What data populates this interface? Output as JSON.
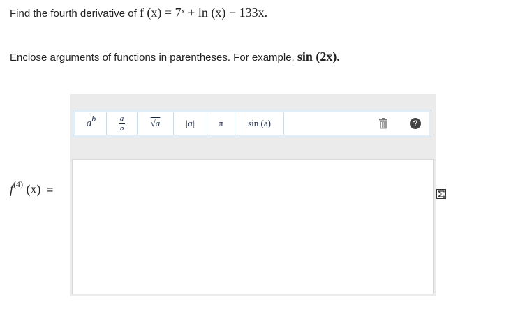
{
  "question": {
    "prefix": "Find the fourth derivative of",
    "expression": "f (x) = 7ˣ + ln (x) − 133x."
  },
  "instructions": {
    "text": "Enclose arguments of functions in parentheses. For example,",
    "example": "sin (2x)."
  },
  "toolbar": {
    "power_base": "a",
    "power_exp": "b",
    "frac_num": "a",
    "frac_den": "b",
    "sqrt_label": "√a",
    "abs_label": "|a|",
    "pi_label": "π",
    "sin_label": "sin (a)",
    "help_label": "?"
  },
  "answer": {
    "lhs_f": "f",
    "lhs_order": "(4)",
    "lhs_arg": "(x)",
    "equals": "=",
    "value": ""
  },
  "colors": {
    "toolbar_border": "#c9d9e6",
    "panel_bg": "#ebebeb",
    "help_bg": "#444444"
  }
}
